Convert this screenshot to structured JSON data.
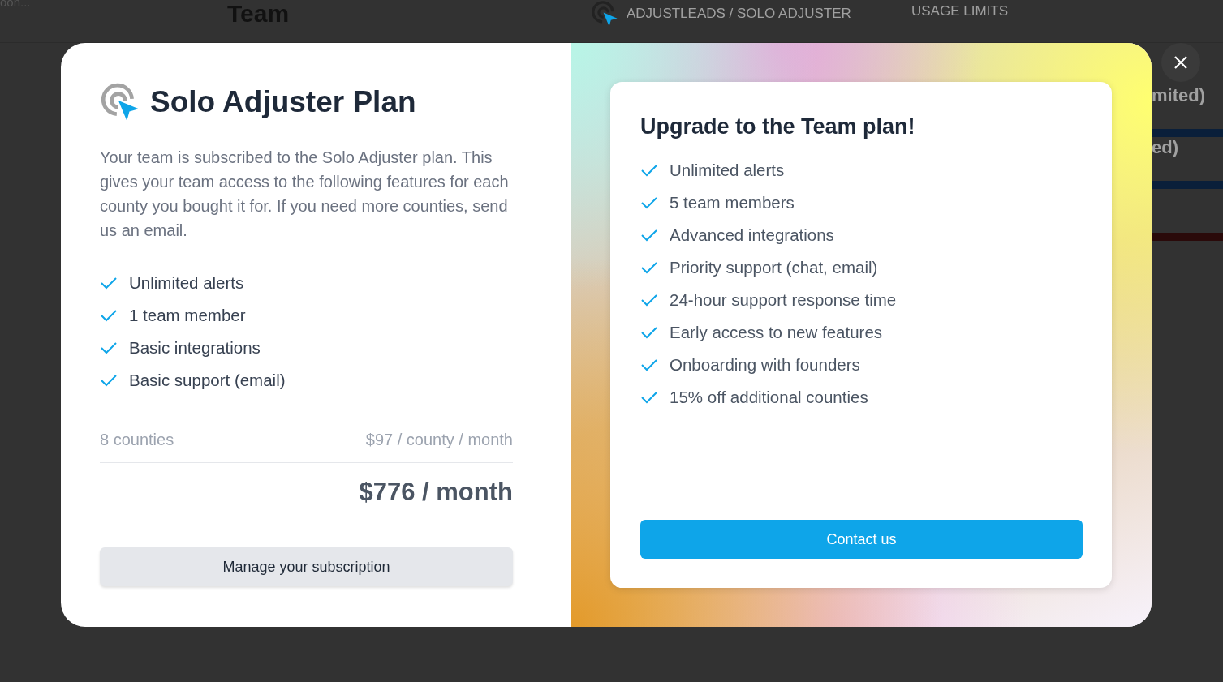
{
  "background_page": {
    "breadcrumb": "oon...",
    "title": "Team",
    "account": "ADJUSTLEADS / SOLO ADJUSTER",
    "usage_tab": "USAGE LIMITS",
    "usage_rows": [
      {
        "text": "mited)",
        "color": "#0a1f3a"
      },
      {
        "text": "ed)",
        "color": "#0a1f3a"
      },
      {
        "text": "",
        "color": "#2a0a0a"
      }
    ]
  },
  "modal": {
    "current_plan": {
      "title": "Solo Adjuster Plan",
      "description": "Your team is subscribed to the Solo Adjuster plan. This gives your team access to the following features for each county you bought it for. If you need more counties, send us an email.",
      "features": [
        "Unlimited alerts",
        "1 team member",
        "Basic integrations",
        "Basic support (email)"
      ],
      "counties": "8 counties",
      "unit_price": "$97 / county / month",
      "total": "$776 / month",
      "manage_button": "Manage your subscription"
    },
    "upgrade": {
      "title": "Upgrade to the Team plan!",
      "features": [
        "Unlimited alerts",
        "5 team members",
        "Advanced integrations",
        "Priority support (chat, email)",
        "24-hour support response time",
        "Early access to new features",
        "Onboarding with founders",
        "15% off additional counties"
      ],
      "contact_button": "Contact us"
    }
  }
}
